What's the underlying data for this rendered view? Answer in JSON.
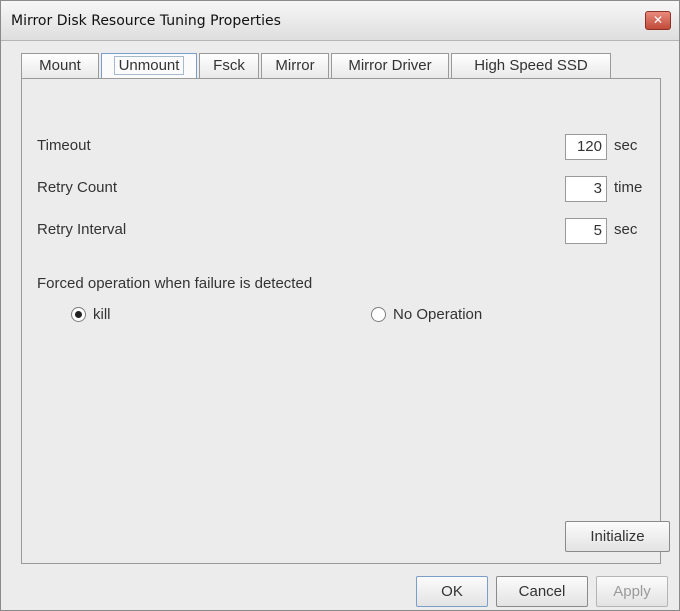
{
  "window": {
    "title": "Mirror Disk Resource Tuning Properties",
    "close_label": "✕"
  },
  "tabs": [
    {
      "label": "Mount"
    },
    {
      "label": "Unmount",
      "active": true
    },
    {
      "label": "Fsck"
    },
    {
      "label": "Mirror"
    },
    {
      "label": "Mirror Driver"
    },
    {
      "label": "High Speed SSD"
    }
  ],
  "fields": {
    "timeout": {
      "label": "Timeout",
      "value": "120",
      "unit": "sec"
    },
    "retry_count": {
      "label": "Retry Count",
      "value": "3",
      "unit": "time"
    },
    "retry_interval": {
      "label": "Retry Interval",
      "value": "5",
      "unit": "sec"
    }
  },
  "forced_operation": {
    "label": "Forced operation when failure is detected",
    "options": [
      {
        "label": "kill",
        "selected": true
      },
      {
        "label": "No Operation",
        "selected": false
      }
    ]
  },
  "buttons": {
    "initialize": "Initialize",
    "ok": "OK",
    "cancel": "Cancel",
    "apply": "Apply"
  }
}
